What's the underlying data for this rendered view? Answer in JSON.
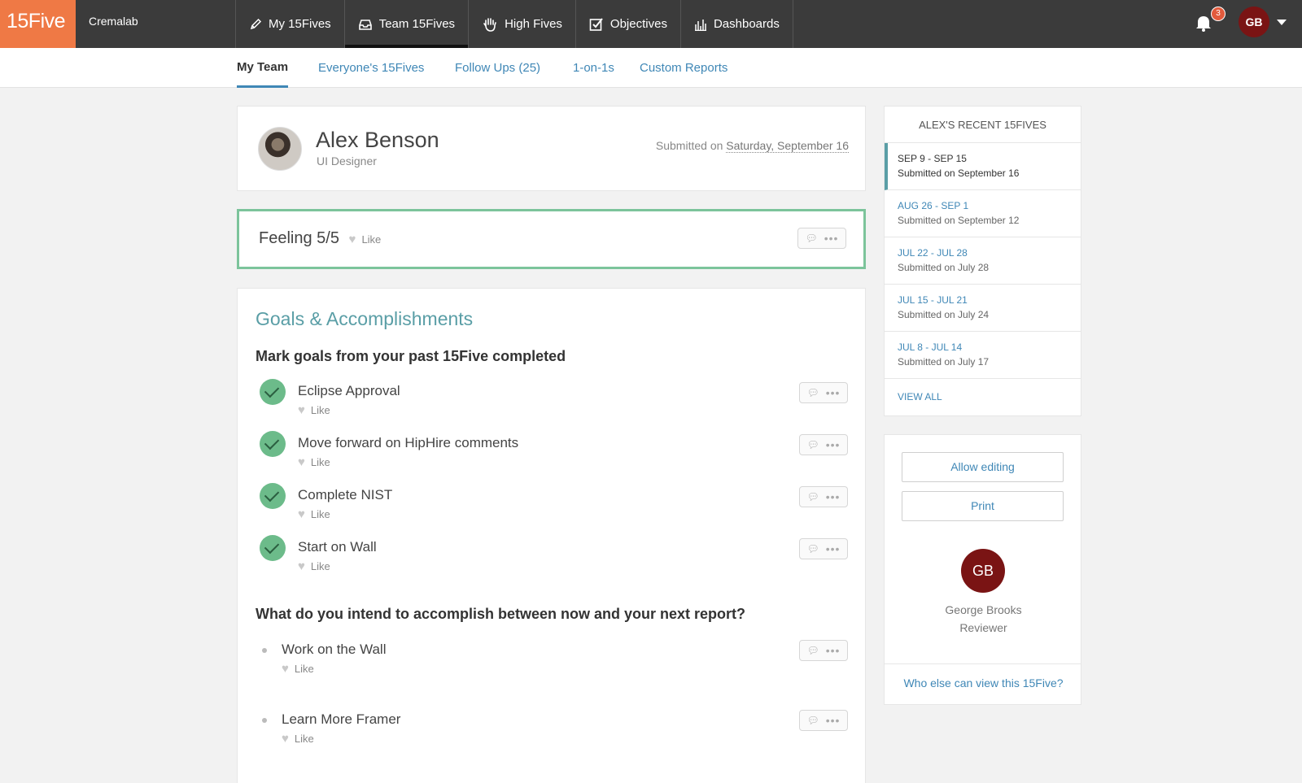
{
  "topnav": {
    "logo": "15Five",
    "company": "Cremalab",
    "tabs": [
      {
        "label": "My 15Fives",
        "icon": "pencil-icon"
      },
      {
        "label": "Team 15Fives",
        "icon": "inbox-icon"
      },
      {
        "label": "High Fives",
        "icon": "hand-icon"
      },
      {
        "label": "Objectives",
        "icon": "checkbox-icon"
      },
      {
        "label": "Dashboards",
        "icon": "bar-chart-icon"
      }
    ],
    "notifications": "3",
    "user_initials": "GB"
  },
  "subnav": {
    "tabs": [
      "My Team",
      "Everyone's 15Fives",
      "Follow Ups (25)",
      "1-on-1s",
      "Custom Reports"
    ]
  },
  "profile": {
    "name": "Alex Benson",
    "role": "UI Designer",
    "submitted_prefix": "Submitted on",
    "submitted_date": "Saturday, September 16"
  },
  "feeling": {
    "label": "Feeling 5/5",
    "like": "Like"
  },
  "goals": {
    "title": "Goals & Accomplishments",
    "completed_question": "Mark goals from your past 15Five completed",
    "completed": [
      {
        "title": "Eclipse Approval",
        "like": "Like"
      },
      {
        "title": "Move forward on HipHire comments",
        "like": "Like"
      },
      {
        "title": "Complete NIST",
        "like": "Like"
      },
      {
        "title": "Start on Wall",
        "like": "Like"
      }
    ],
    "intend_question": "What do you intend to accomplish between now and your next report?",
    "intended": [
      {
        "title": "Work on the Wall",
        "like": "Like"
      },
      {
        "title": "Learn More Framer",
        "like": "Like"
      }
    ]
  },
  "recent": {
    "title": "ALEX'S RECENT 15FIVES",
    "items": [
      {
        "range": "SEP 9 - SEP 15",
        "submitted": "Submitted on September 16"
      },
      {
        "range": "AUG 26 - SEP 1",
        "submitted": "Submitted on September 12"
      },
      {
        "range": "JUL 22 - JUL 28",
        "submitted": "Submitted on July 28"
      },
      {
        "range": "JUL 15 - JUL 21",
        "submitted": "Submitted on July 24"
      },
      {
        "range": "JUL 8 - JUL 14",
        "submitted": "Submitted on July 17"
      }
    ],
    "view_all": "VIEW ALL"
  },
  "review": {
    "allow_editing": "Allow editing",
    "print": "Print",
    "reviewer_initials": "GB",
    "reviewer_name": "George Brooks",
    "reviewer_role": "Reviewer",
    "who_else": "Who else can view this 15Five?"
  },
  "colors": {
    "brand": "#ef7945",
    "nav_bg": "#3b3b3b",
    "link": "#3f87b6",
    "success": "#6cbb8a",
    "accent_teal": "#5a9ea6",
    "avatar_red": "#7a1414"
  }
}
